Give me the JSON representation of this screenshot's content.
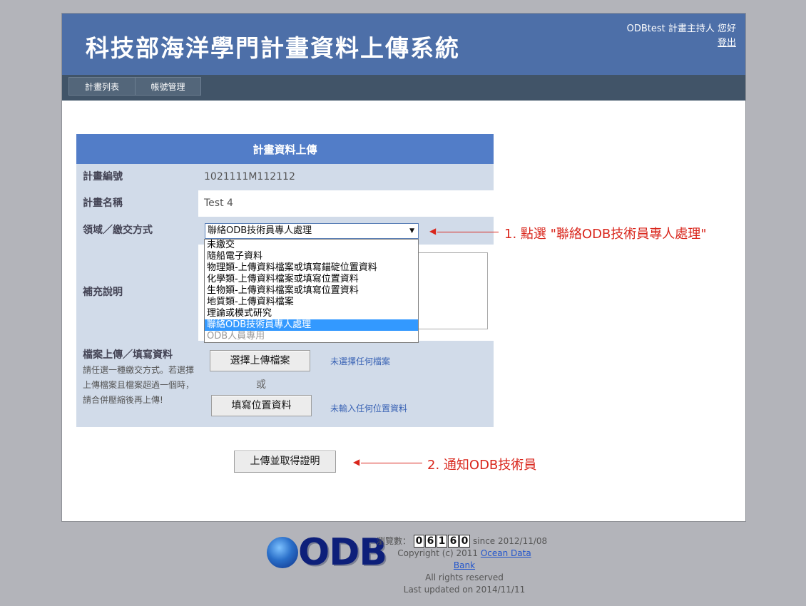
{
  "header": {
    "title": "科技部海洋學門計畫資料上傳系統",
    "greeting": "ODBtest 計畫主持人 您好",
    "logout": "登出"
  },
  "nav": {
    "items": [
      "計畫列表",
      "帳號管理"
    ]
  },
  "form": {
    "title": "計畫資料上傳",
    "project_no_label": "計畫編號",
    "project_no": "1021111M112112",
    "project_name_label": "計畫名稱",
    "project_name": "Test 4",
    "field_label": "領域／繳交方式",
    "field_selected": "聯絡ODB技術員專人處理",
    "field_options": [
      "未繳交",
      "隨船電子資料",
      "物理類-上傳資料檔案或填寫錨碇位置資料",
      "化學類-上傳資料檔案或填寫位置資料",
      "生物類-上傳資料檔案或填寫位置資料",
      "地質類-上傳資料檔案",
      "理論或模式研究",
      "聯絡ODB技術員專人處理",
      "ODB人員專用"
    ],
    "supplement_label": "補充說明",
    "upload_label": "檔案上傳／填寫資料",
    "upload_note": "請任選一種繳交方式。若選擇上傳檔案且檔案超過一個時，請合併壓縮後再上傳!",
    "choose_file_button": "選擇上傳檔案",
    "no_file_text": "未選擇任何檔案",
    "or_text": "或",
    "fill_location_button": "填寫位置資料",
    "no_location_text": "未輸入任何位置資料",
    "submit_button": "上傳並取得證明"
  },
  "annotations": {
    "step1": "1. 點選 \"聯絡ODB技術員專人處理\"",
    "step2": "2. 通知ODB技術員"
  },
  "footer": {
    "logo": "ODB",
    "views_label": "瀏覽數：",
    "counter": [
      "0",
      "6",
      "1",
      "6",
      "0"
    ],
    "since": "since 2012/11/08",
    "copyright_prefix": "Copyright (c) 2011",
    "copyright_link": "Ocean Data Bank",
    "rights": "All rights reserved",
    "updated": "Last updated on 2014/11/11"
  },
  "colors": {
    "header_bg": "#4d6fa8",
    "nav_bg": "#415468",
    "panel_head": "#527dc8",
    "row_blue": "#d1dbe9",
    "annotation_red": "#d9261c",
    "selected_option": "#3399ff"
  }
}
